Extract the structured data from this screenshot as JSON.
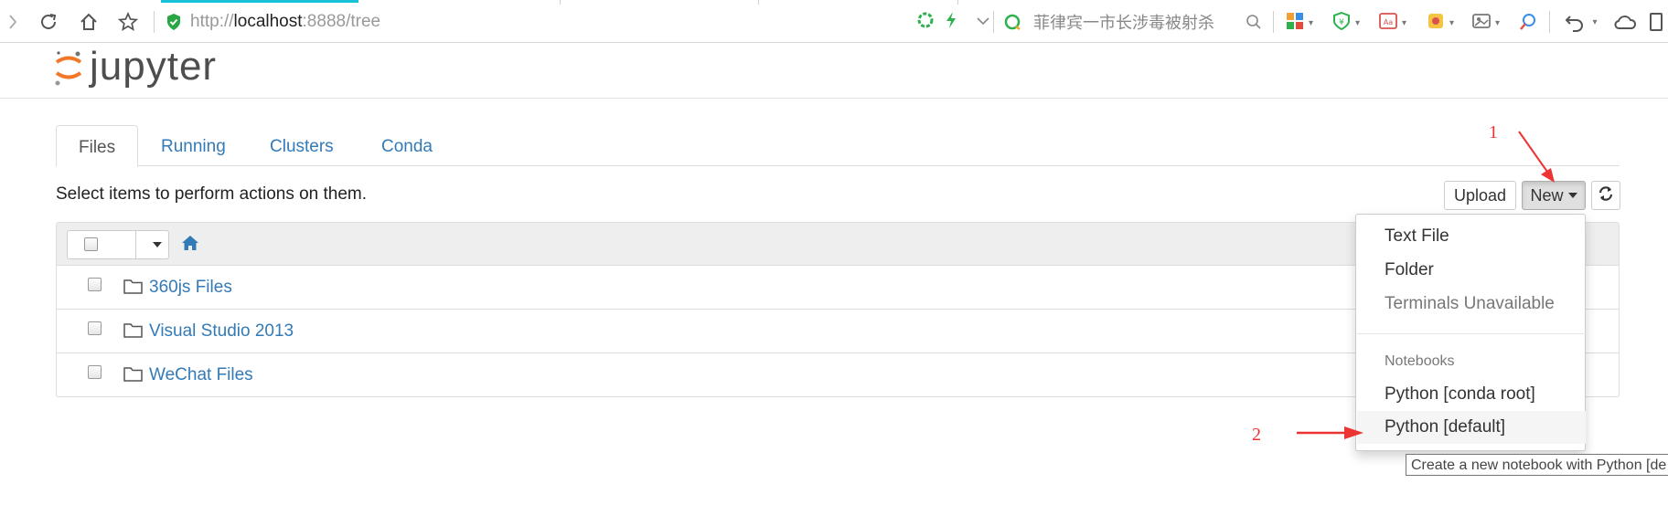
{
  "browser": {
    "url_prefix": "http://",
    "url_host": "localhost",
    "url_rest": ":8888/tree",
    "search_placeholder": "菲律宾一市长涉毒被射杀",
    "accent_color": "#17c1d6"
  },
  "app": {
    "logo_text": "jupyter"
  },
  "tabs": [
    {
      "label": "Files",
      "active": true
    },
    {
      "label": "Running",
      "active": false
    },
    {
      "label": "Clusters",
      "active": false
    },
    {
      "label": "Conda",
      "active": false
    }
  ],
  "toolbar": {
    "hint": "Select items to perform actions on them.",
    "upload_label": "Upload",
    "new_label": "New"
  },
  "files": [
    {
      "name": "360js Files",
      "type": "folder"
    },
    {
      "name": "Visual Studio 2013",
      "type": "folder"
    },
    {
      "name": "WeChat Files",
      "type": "folder"
    }
  ],
  "new_menu": {
    "items": [
      {
        "label": "Text File",
        "enabled": true
      },
      {
        "label": "Folder",
        "enabled": true
      },
      {
        "label": "Terminals Unavailable",
        "enabled": false
      }
    ],
    "section_header": "Notebooks",
    "kernels": [
      {
        "label": "Python [conda root]"
      },
      {
        "label": "Python [default]"
      }
    ]
  },
  "tooltip": "Create a new notebook with Python [de",
  "annotations": {
    "step1": "1",
    "step2": "2",
    "color": "#e33333"
  }
}
